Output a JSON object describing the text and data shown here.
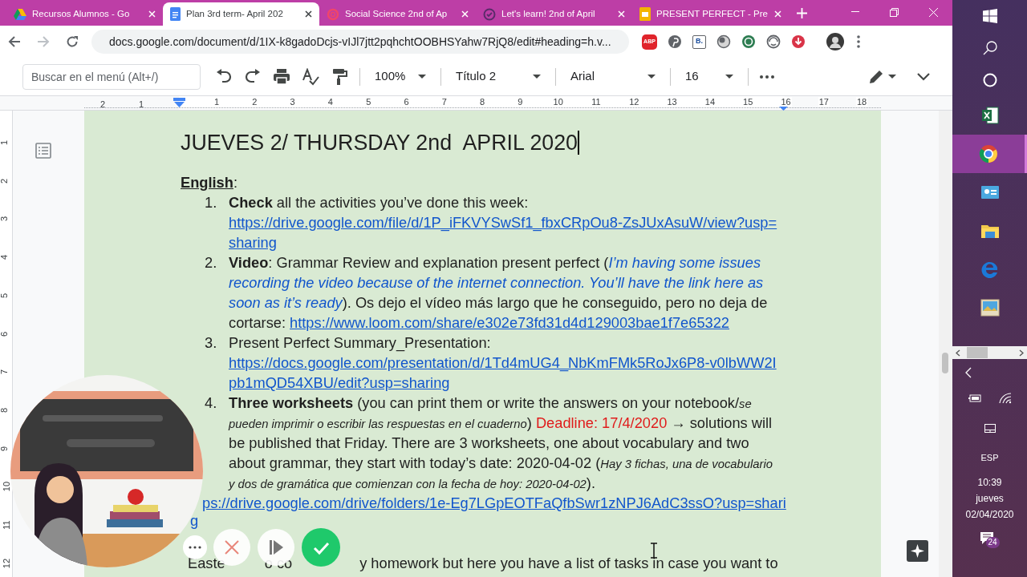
{
  "browser": {
    "tabs": [
      {
        "title": "Recursos Alumnos - Go",
        "selected": false
      },
      {
        "title": "Plan 3rd term- April 202",
        "selected": true
      },
      {
        "title": "Social Science 2nd of Ap",
        "selected": false
      },
      {
        "title": "Let's learn! 2nd of April",
        "selected": false
      },
      {
        "title": "PRESENT PERFECT - Pre",
        "selected": false
      }
    ],
    "url": "docs.google.com/document/d/1IX-k8gadoDcjs-vIJl7jtt2pqhchtOOBHSYahw7RjQ8/edit#heading=h.v...",
    "extensions": [
      "ABP",
      "B."
    ]
  },
  "toolbar": {
    "search_placeholder": "Buscar en el menú (Alt+/)",
    "zoom": "100%",
    "style": "Título 2",
    "font": "Arial",
    "size": "16"
  },
  "ruler": {
    "left_labels": [
      "2",
      "1"
    ],
    "labels": [
      "1",
      "2",
      "3",
      "4",
      "5",
      "6",
      "7",
      "8",
      "9",
      "10",
      "11",
      "12",
      "13",
      "14",
      "15",
      "16",
      "17",
      "18"
    ],
    "vertical_labels": [
      "1",
      "2",
      "3",
      "4",
      "5",
      "6",
      "7",
      "8",
      "9",
      "10",
      "11",
      "12"
    ]
  },
  "document": {
    "title": "JUEVES 2/ THURSDAY 2nd  APRIL 2020",
    "heading": {
      "label": "English",
      "suffix": ":"
    },
    "items": [
      {
        "number": "1.",
        "runs": [
          {
            "kind": "bold",
            "text": "Check"
          },
          {
            "kind": "text",
            "text": " all the activities you’ve done this week:"
          }
        ],
        "link": "https://drive.google.com/file/d/1P_iFKVYSwSf1_fbxCRpOu8-ZsJUxAsuW/view?usp=sharing"
      },
      {
        "number": "2.",
        "runs": [
          {
            "kind": "bold",
            "text": "Video"
          },
          {
            "kind": "text",
            "text": ": Grammar Review and explanation present perfect ("
          },
          {
            "kind": "note",
            "text": "I’m having some issues recording the video because of the internet connection. You’ll have the link here as soon as it’s ready"
          },
          {
            "kind": "text",
            "text": "). Os dejo el vídeo más largo que he conseguido, pero no deja de cortarse: "
          },
          {
            "kind": "link",
            "text": "https://www.loom.com/share/e302e73fd31d4d129003bae1f7e65322"
          }
        ]
      },
      {
        "number": "3.",
        "runs": [
          {
            "kind": "text",
            "text": "Present Perfect Summary_Presentation:"
          }
        ],
        "link": "https://docs.google.com/presentation/d/1Td4mUG4_NbKmFMk5RoJx6P8-v0lbWW2Ipb1mQD54XBU/edit?usp=sharing"
      },
      {
        "number": "4.",
        "runs": [
          {
            "kind": "bold",
            "text": "Three worksheets"
          },
          {
            "kind": "text",
            "text": " (you can print them or write the answers on your notebook/"
          },
          {
            "kind": "small_italic",
            "text": "se pueden imprimir o escribir las respuestas en el cuaderno"
          },
          {
            "kind": "text",
            "text": ") "
          },
          {
            "kind": "deadline",
            "text": "Deadline: 17/4/2020"
          },
          {
            "kind": "text",
            "text": " → solutions will be published that Friday. There are 3 worksheets, one about vocabulary and two about grammar, they start with today’s date: 2020-04-02 ("
          },
          {
            "kind": "small_italic",
            "text": "Hay 3 fichas, una de vocabulario y dos de gramática que comienzan con la fecha de hoy: 2020-04-02"
          },
          {
            "kind": "text",
            "text": ")."
          }
        ]
      }
    ],
    "folder_link": [
      "ps://drive.google.com/drive/folders/1e-Eg7LGpEOTFaQfbSwr1zNPJ6AdC3ssO?usp=shari",
      "g"
    ],
    "last_line": [
      "Easte",
      "o co",
      "y homework but here you have a list of tasks in case you want to"
    ]
  },
  "taskbar": {
    "apps": [
      {
        "selected": false
      },
      {
        "selected": true
      },
      {
        "selected": false
      },
      {
        "selected": false
      },
      {
        "selected": false
      },
      {
        "selected": false
      }
    ],
    "language": "ESP",
    "time": "10:39",
    "day": "jueves",
    "date": "02/04/2020",
    "notifications": "24"
  }
}
